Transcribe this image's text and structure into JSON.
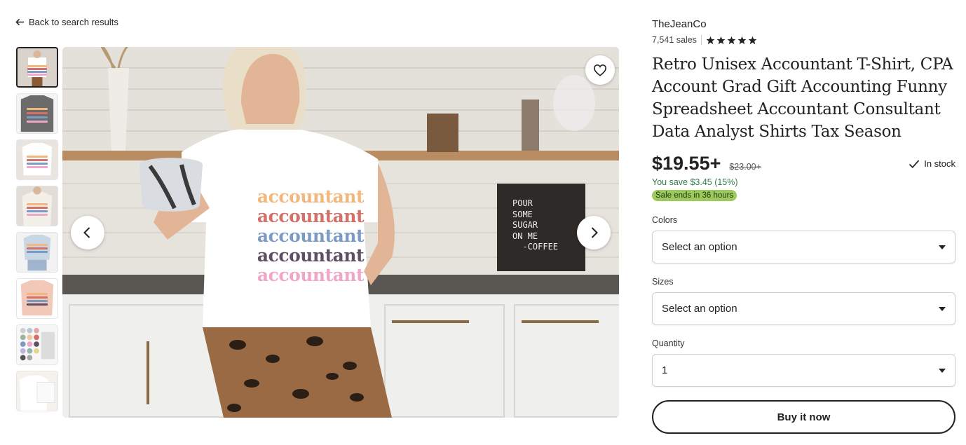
{
  "nav": {
    "back_label": "Back to search results"
  },
  "gallery": {
    "shirt_words": [
      "accountant",
      "accountant",
      "accountant",
      "accountant",
      "accountant"
    ],
    "shirt_word_colors": [
      "#f2b77c",
      "#d2706a",
      "#7c9bc4",
      "#5f4f66",
      "#f0a6c9"
    ],
    "sign_text": [
      "POUR",
      "SOME",
      "SUGAR",
      "ON ME",
      "  -COFFEE"
    ],
    "thumbnail_count": 8
  },
  "shop": {
    "name": "TheJeanCo",
    "sales": "7,541 sales",
    "rating_stars": 5
  },
  "product": {
    "title": "Retro Unisex Accountant T-Shirt, CPA Account Grad Gift Accounting Funny Spreadsheet Accountant Consultant Data Analyst Shirts Tax Season",
    "price": "$19.55+",
    "original_price": "$23.00+",
    "stock": "In stock",
    "savings": "You save $3.45 (15%)",
    "sale_badge": "Sale ends in 36 hours"
  },
  "options": {
    "colors_label": "Colors",
    "colors_value": "Select an option",
    "sizes_label": "Sizes",
    "sizes_value": "Select an option",
    "quantity_label": "Quantity",
    "quantity_value": "1"
  },
  "actions": {
    "buy_label": "Buy it now"
  },
  "colors": {
    "text": "#222222",
    "savings": "#2f7d4a",
    "sale_badge": "#9ec95d"
  }
}
